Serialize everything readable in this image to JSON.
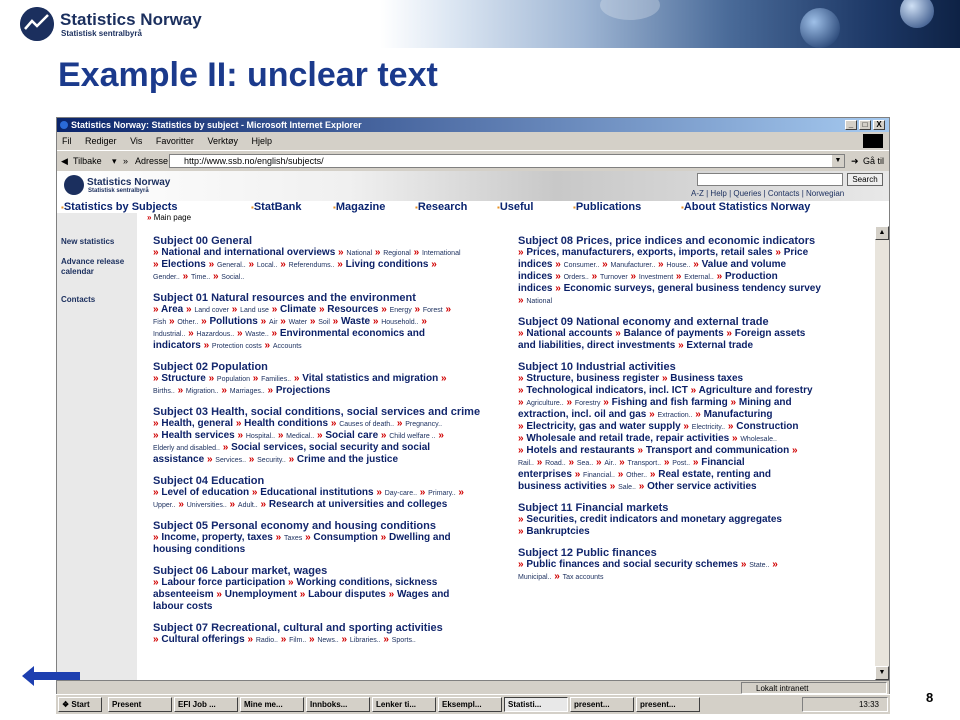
{
  "slide": {
    "brand": "Statistics Norway",
    "brand_sub": "Statistisk sentralbyrå",
    "title": "Example II: unclear text",
    "number": "8"
  },
  "browser": {
    "title": "Statistics Norway: Statistics by subject - Microsoft Internet Explorer",
    "window_buttons": [
      "_",
      "□",
      "X"
    ],
    "menu": [
      "Fil",
      "Rediger",
      "Vis",
      "Favoritter",
      "Verktøy",
      "Hjelp"
    ],
    "back_label": "Tilbake",
    "address_label": "Adresse",
    "url": "http://www.ssb.no/english/subjects/",
    "go_label": "Gå til",
    "status_zone": "Lokalt intranett"
  },
  "site": {
    "name": "Statistics Norway",
    "sub": "Statistisk sentralbyrå",
    "search_label": "Search",
    "toplinks": "A-Z  |  Help  |  Queries  |  Contacts  |  Norwegian",
    "nav": [
      "Statistics by Subjects",
      "StatBank",
      "Magazine",
      "Research",
      "Useful",
      "Publications",
      "About Statistics Norway"
    ],
    "breadcrumb": "Main page",
    "leftnav": [
      "New statistics",
      "Advance release calendar",
      "Contacts"
    ]
  },
  "subjects_left": [
    {
      "title": "Subject 00 General",
      "lines": [
        [
          [
            "m",
            "National and international overviews"
          ],
          [
            "s",
            "National"
          ],
          [
            "s",
            "Regional"
          ],
          [
            "s",
            "International"
          ]
        ],
        [
          [
            "m",
            "Elections"
          ],
          [
            "s",
            "General.."
          ],
          [
            "s",
            "Local.."
          ],
          [
            "s",
            "Referendums.."
          ],
          [
            "m",
            "Living conditions"
          ],
          [
            "s",
            ""
          ]
        ],
        [
          [
            "s0",
            "Gender.."
          ],
          [
            "s",
            "Time.."
          ],
          [
            "s",
            "Social.."
          ]
        ]
      ]
    },
    {
      "title": "Subject 01 Natural resources and the environment",
      "lines": [
        [
          [
            "m",
            "Area"
          ],
          [
            "s",
            "Land cover"
          ],
          [
            "s",
            "Land use"
          ],
          [
            "m",
            "Climate"
          ],
          [
            "m",
            "Resources"
          ],
          [
            "s",
            "Energy"
          ],
          [
            "s",
            "Forest"
          ],
          [
            "s",
            ""
          ]
        ],
        [
          [
            "s0",
            "Fish"
          ],
          [
            "s",
            "Other.."
          ],
          [
            "m",
            "Pollutions"
          ],
          [
            "s",
            "Air"
          ],
          [
            "s",
            "Water"
          ],
          [
            "s",
            "Soil"
          ],
          [
            "m",
            "Waste"
          ],
          [
            "s",
            "Household.."
          ],
          [
            "s",
            ""
          ]
        ],
        [
          [
            "s0",
            "Industrial.."
          ],
          [
            "s",
            "Hazardous.."
          ],
          [
            "s",
            "Waste.."
          ],
          [
            "m",
            "Environmental economics and"
          ]
        ],
        [
          [
            "t",
            "indicators"
          ],
          [
            "s",
            "Protection costs"
          ],
          [
            "s",
            "Accounts"
          ]
        ]
      ]
    },
    {
      "title": "Subject 02 Population",
      "lines": [
        [
          [
            "m",
            "Structure"
          ],
          [
            "s",
            "Population"
          ],
          [
            "s",
            "Families.."
          ],
          [
            "m",
            "Vital statistics and migration"
          ],
          [
            "s",
            ""
          ]
        ],
        [
          [
            "s0",
            "Births.."
          ],
          [
            "s",
            "Migration.."
          ],
          [
            "s",
            "Marriages.."
          ],
          [
            "m",
            "Projections"
          ]
        ]
      ]
    },
    {
      "title": "Subject 03 Health, social conditions, social services and crime",
      "lines": [
        [
          [
            "m",
            "Health, general"
          ],
          [
            "m",
            "Health conditions"
          ],
          [
            "s",
            "Causes of death.."
          ],
          [
            "s",
            "Pregnancy.."
          ]
        ],
        [
          [
            "m",
            "Health services"
          ],
          [
            "s",
            "Hospital.."
          ],
          [
            "s",
            "Medical.."
          ],
          [
            "m",
            "Social care"
          ],
          [
            "s",
            "Child welfare .."
          ],
          [
            "s",
            ""
          ]
        ],
        [
          [
            "s0",
            "Elderly and disabled.."
          ],
          [
            "m",
            "Social services, social security and social"
          ]
        ],
        [
          [
            "t",
            "assistance"
          ],
          [
            "s",
            "Services.."
          ],
          [
            "s",
            "Security.."
          ],
          [
            "m",
            "Crime and the justice"
          ]
        ]
      ]
    },
    {
      "title": "Subject 04 Education",
      "lines": [
        [
          [
            "m",
            "Level of education"
          ],
          [
            "m",
            "Educational institutions"
          ],
          [
            "s",
            "Day-care.."
          ],
          [
            "s",
            "Primary.."
          ],
          [
            "s",
            ""
          ]
        ],
        [
          [
            "s0",
            "Upper.."
          ],
          [
            "s",
            "Universities.."
          ],
          [
            "s",
            "Adult.."
          ],
          [
            "m",
            "Research at universities and colleges"
          ]
        ]
      ]
    },
    {
      "title": "Subject 05 Personal economy and housing conditions",
      "lines": [
        [
          [
            "m",
            "Income, property, taxes"
          ],
          [
            "s",
            "Taxes"
          ],
          [
            "m",
            "Consumption"
          ],
          [
            "m",
            "Dwelling and"
          ]
        ],
        [
          [
            "t",
            "housing conditions"
          ]
        ]
      ]
    },
    {
      "title": "Subject 06 Labour market, wages",
      "lines": [
        [
          [
            "m",
            "Labour force participation"
          ],
          [
            "m",
            "Working conditions, sickness"
          ]
        ],
        [
          [
            "t",
            "absenteeism"
          ],
          [
            "m",
            "Unemployment"
          ],
          [
            "m",
            "Labour disputes"
          ],
          [
            "m",
            "Wages and"
          ]
        ],
        [
          [
            "t",
            "labour costs"
          ]
        ]
      ]
    },
    {
      "title": "Subject 07 Recreational, cultural and sporting activities",
      "lines": [
        [
          [
            "m",
            "Cultural offerings"
          ],
          [
            "s",
            "Radio.."
          ],
          [
            "s",
            "Film.."
          ],
          [
            "s",
            "News.."
          ],
          [
            "s",
            "Libraries.."
          ],
          [
            "s",
            "Sports.."
          ]
        ]
      ]
    }
  ],
  "subjects_right": [
    {
      "title": "Subject 08 Prices, price indices and economic indicators",
      "lines": [
        [
          [
            "m",
            "Prices, manufacturers, exports, imports, retail sales"
          ],
          [
            "m",
            "Price"
          ]
        ],
        [
          [
            "t",
            "indices"
          ],
          [
            "s",
            "Consumer.."
          ],
          [
            "s",
            "Manufacturer.."
          ],
          [
            "s",
            "House.."
          ],
          [
            "m",
            "Value and volume"
          ]
        ],
        [
          [
            "t",
            "indices"
          ],
          [
            "s",
            "Orders.."
          ],
          [
            "s",
            "Turnover"
          ],
          [
            "s",
            "Investment"
          ],
          [
            "s",
            "External.."
          ],
          [
            "m",
            "Production"
          ]
        ],
        [
          [
            "t",
            "indices"
          ],
          [
            "m",
            "Economic surveys, general business tendency survey"
          ]
        ],
        [
          [
            "s",
            "National"
          ]
        ]
      ]
    },
    {
      "title": "Subject 09 National economy and external trade",
      "lines": [
        [
          [
            "m",
            "National accounts"
          ],
          [
            "m",
            "Balance of payments"
          ],
          [
            "m",
            "Foreign assets"
          ]
        ],
        [
          [
            "t",
            "and liabilities, direct investments"
          ],
          [
            "m",
            "External trade"
          ]
        ]
      ]
    },
    {
      "title": "Subject 10 Industrial activities",
      "lines": [
        [
          [
            "m",
            "Structure, business register"
          ],
          [
            "m",
            "Business taxes"
          ]
        ],
        [
          [
            "m",
            "Technological indicators, incl. ICT"
          ],
          [
            "m",
            "Agriculture and forestry"
          ]
        ],
        [
          [
            "s",
            "Agriculture.."
          ],
          [
            "s",
            "Forestry"
          ],
          [
            "m",
            "Fishing and fish farming"
          ],
          [
            "m",
            "Mining and"
          ]
        ],
        [
          [
            "t",
            "extraction, incl. oil and gas"
          ],
          [
            "s",
            "Extraction.."
          ],
          [
            "m",
            "Manufacturing"
          ]
        ],
        [
          [
            "m",
            "Electricity, gas and water supply"
          ],
          [
            "s",
            "Electricity.."
          ],
          [
            "m",
            "Construction"
          ]
        ],
        [
          [
            "m",
            "Wholesale and retail trade, repair activities"
          ],
          [
            "s",
            "Wholesale.."
          ]
        ],
        [
          [
            "m",
            "Hotels and restaurants"
          ],
          [
            "m",
            "Transport and communication"
          ],
          [
            "s",
            ""
          ]
        ],
        [
          [
            "s0",
            "Rail.."
          ],
          [
            "s",
            "Road.."
          ],
          [
            "s",
            "Sea.."
          ],
          [
            "s",
            "Air.."
          ],
          [
            "s",
            "Transport.."
          ],
          [
            "s",
            "Post.."
          ],
          [
            "m",
            "Financial"
          ]
        ],
        [
          [
            "t",
            "enterprises"
          ],
          [
            "s",
            "Financial.."
          ],
          [
            "s",
            "Other.."
          ],
          [
            "m",
            "Real estate, renting and"
          ]
        ],
        [
          [
            "t",
            "business activities"
          ],
          [
            "s",
            "Sale.."
          ],
          [
            "m",
            "Other service activities"
          ]
        ]
      ]
    },
    {
      "title": "Subject 11 Financial markets",
      "lines": [
        [
          [
            "m",
            "Securities, credit indicators and monetary aggregates"
          ]
        ],
        [
          [
            "m",
            "Bankruptcies"
          ]
        ]
      ]
    },
    {
      "title": "Subject 12 Public finances",
      "lines": [
        [
          [
            "m",
            "Public finances and social security schemes"
          ],
          [
            "s",
            "State.."
          ],
          [
            "s",
            ""
          ]
        ],
        [
          [
            "s0",
            "Municipal.."
          ],
          [
            "s",
            "Tax accounts"
          ]
        ]
      ]
    }
  ],
  "taskbar": {
    "start": "Start",
    "items": [
      "Present",
      "EFI Job ...",
      "Mine me...",
      "Innboks...",
      "Lenker ti...",
      "Eksempl...",
      "Statisti...",
      "present...",
      "present..."
    ],
    "active_index": 6,
    "clock": "13:33"
  }
}
